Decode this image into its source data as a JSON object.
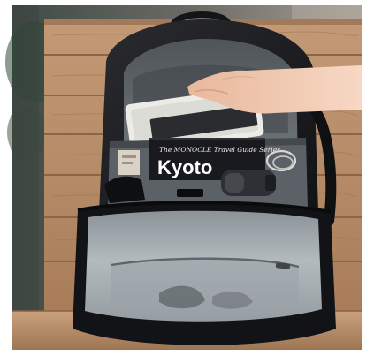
{
  "photo": {
    "subject": "",
    "guidebook": {
      "series": "The MONOCLE Travel Guide Series",
      "title": "Kyoto"
    }
  },
  "colors": {
    "wood": "#b98d68",
    "wood_dark": "#8c6547",
    "bag": "#1c1d20",
    "lining": "#6d7378",
    "lining_light": "#aab1b6",
    "tablet": "#ecebe6",
    "skin": "#f0c9b0"
  }
}
